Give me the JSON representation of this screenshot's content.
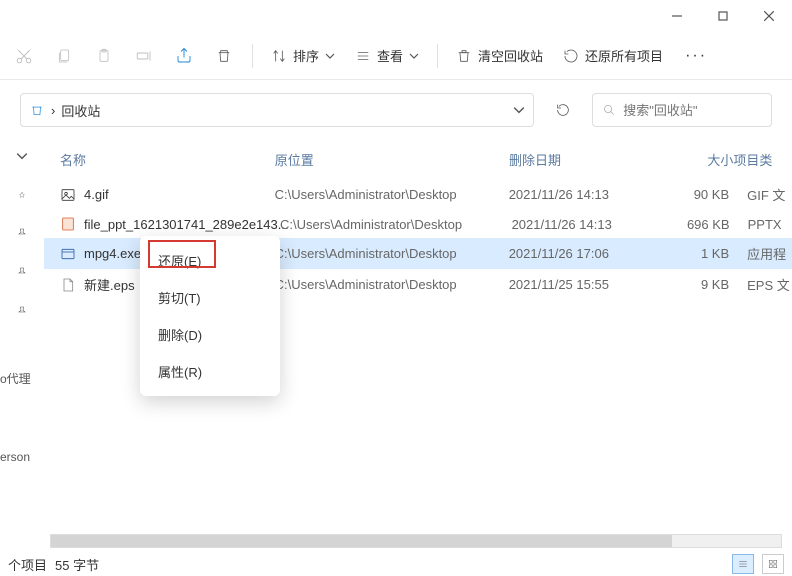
{
  "window": {
    "minimize": "—",
    "maximize": "☐",
    "close": "✕"
  },
  "toolbar": {
    "sort_label": "排序",
    "view_label": "查看",
    "empty_label": "清空回收站",
    "restore_all_label": "还原所有项目"
  },
  "breadcrumb": {
    "sep": "›",
    "location": "回收站"
  },
  "search": {
    "placeholder": "搜索\"回收站\""
  },
  "columns": {
    "name": "名称",
    "location": "原位置",
    "date": "删除日期",
    "size": "大小",
    "type": "项目类"
  },
  "files": [
    {
      "name": "4.gif",
      "location": "C:\\Users\\Administrator\\Desktop",
      "date": "2021/11/26 14:13",
      "size": "90 KB",
      "type": "GIF 文",
      "icon": "image"
    },
    {
      "name": "file_ppt_1621301741_289e2e143...",
      "location": "C:\\Users\\Administrator\\Desktop",
      "date": "2021/11/26 14:13",
      "size": "696 KB",
      "type": "PPTX",
      "icon": "ppt"
    },
    {
      "name": "mpg4.exe",
      "location": "C:\\Users\\Administrator\\Desktop",
      "date": "2021/11/26 17:06",
      "size": "1 KB",
      "type": "应用程",
      "icon": "exe",
      "selected": true
    },
    {
      "name": "新建.eps",
      "location": "C:\\Users\\Administrator\\Desktop",
      "date": "2021/11/25 15:55",
      "size": "9 KB",
      "type": "EPS 文",
      "icon": "generic"
    }
  ],
  "context_menu": {
    "restore": "还原(E)",
    "cut": "剪切(T)",
    "delete": "删除(D)",
    "properties": "属性(R)"
  },
  "sidebar": {
    "label1": "o代理",
    "label2": "erson"
  },
  "status": {
    "items": "个项目",
    "bytes": "55 字节"
  }
}
